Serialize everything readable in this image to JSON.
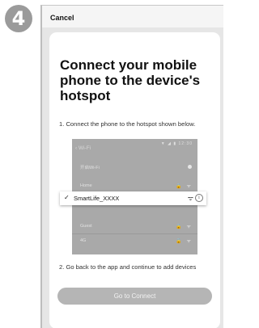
{
  "step_badge": "4",
  "topbar": {
    "cancel_label": "Cancel"
  },
  "main": {
    "title": "Connect your mobile phone to the device's hotspot",
    "instruction1": "1. Connect the phone to the hotspot shown below.",
    "instruction2": "2. Go back to the app and continue to add devices",
    "button_label": "Go to Connect"
  },
  "wifi_panel": {
    "status_bar": "▼ ◢ ▮ 12:30",
    "header": "‹  Wi-Fi",
    "rows": [
      {
        "label": "开启Wi-Fi"
      },
      {
        "label": "Home",
        "icons": "🔒 ᯤ"
      },
      {
        "label": "Guest",
        "icons": "🔒 ᯤ"
      },
      {
        "label": "4G",
        "icons": "🔒 ᯤ"
      }
    ],
    "selected": {
      "check": "✓",
      "ssid": "SmartLife_XXXX",
      "signal": "ᯤ",
      "info": "i"
    }
  },
  "colors": {
    "button": "#b5b5b5",
    "badge": "#9b9b9b",
    "wifi_bg": "#a9a9a9"
  }
}
